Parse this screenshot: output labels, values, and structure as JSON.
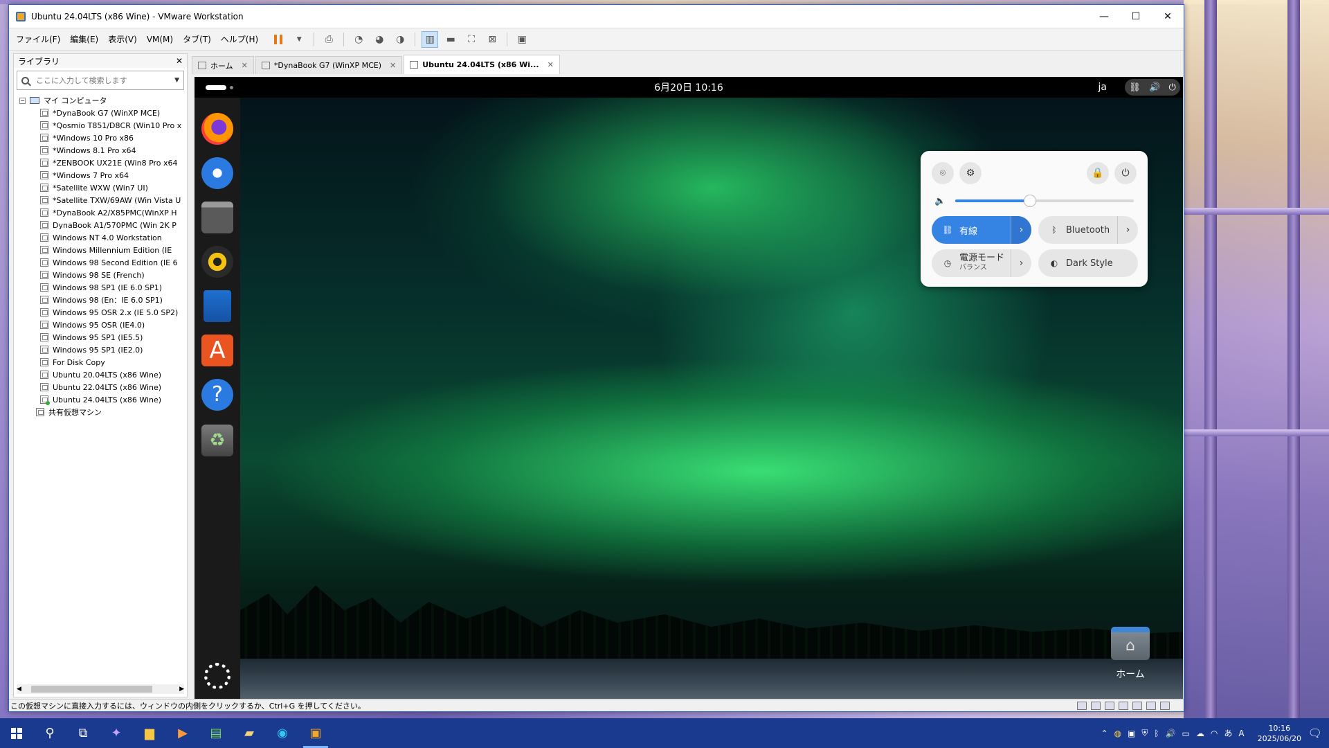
{
  "vmware": {
    "title": "Ubuntu 24.04LTS (x86 Wine) - VMware Workstation",
    "controls": {
      "minimize": "—",
      "maximize": "☐",
      "close": "✕"
    },
    "menu": [
      "ファイル(F)",
      "編集(E)",
      "表示(V)",
      "VM(M)",
      "タブ(T)",
      "ヘルプ(H)"
    ],
    "library": {
      "title": "ライブラリ",
      "close": "✕",
      "search_placeholder": "ここに入力して検索します",
      "root": "マイ コンピュータ",
      "vms": [
        "*DynaBook G7 (WinXP MCE)",
        "*Qosmio T851/D8CR (Win10 Pro x",
        "*Windows 10 Pro x86",
        "*Windows 8.1 Pro x64",
        "*ZENBOOK UX21E (Win8 Pro x64",
        "*Windows 7 Pro x64",
        "*Satellite WXW (Win7 UI)",
        "*Satellite TXW/69AW (Win Vista U",
        "*DynaBook A2/X85PMC(WinXP H",
        "DynaBook A1/570PMC (Win 2K P",
        "Windows NT 4.0 Workstation",
        "Windows Millennium Edition (IE",
        "Windows 98 Second Edition (IE 6",
        "Windows 98 SE (French)",
        "Windows 98 SP1 (IE 6.0 SP1)",
        "Windows 98 (En：IE 6.0 SP1)",
        "Windows 95 OSR 2.x (IE 5.0 SP2)",
        "Windows 95 OSR (IE4.0)",
        "Windows 95 SP1 (IE5.5)",
        "Windows 95 SP1 (IE2.0)",
        "For Disk Copy",
        "Ubuntu 20.04LTS (x86 Wine)",
        "Ubuntu 22.04LTS (x86 Wine)",
        "Ubuntu 24.04LTS (x86 Wine)"
      ],
      "shared": "共有仮想マシン"
    },
    "tabs": [
      {
        "label": "ホーム",
        "active": false
      },
      {
        "label": "*DynaBook G7 (WinXP MCE)",
        "active": false
      },
      {
        "label": "Ubuntu 24.04LTS (x86 Wi...",
        "active": true
      }
    ],
    "status_text": "この仮想マシンに直接入力するには、ウィンドウの内側をクリックするか、Ctrl+G を押してください。"
  },
  "ubuntu": {
    "clock": "6月20日  10:16",
    "lang": "ja",
    "quick_settings": {
      "volume_percent": 42,
      "wired_label": "有線",
      "bluetooth_label": "Bluetooth",
      "power_label": "電源モード",
      "power_sub": "バランス",
      "dark_label": "Dark Style"
    },
    "desktop_home_label": "ホーム"
  },
  "taskbar": {
    "time": "10:16",
    "date": "2025/06/20"
  },
  "colors": {
    "accent": "#3584e4",
    "taskbar": "#1a3a8f"
  }
}
